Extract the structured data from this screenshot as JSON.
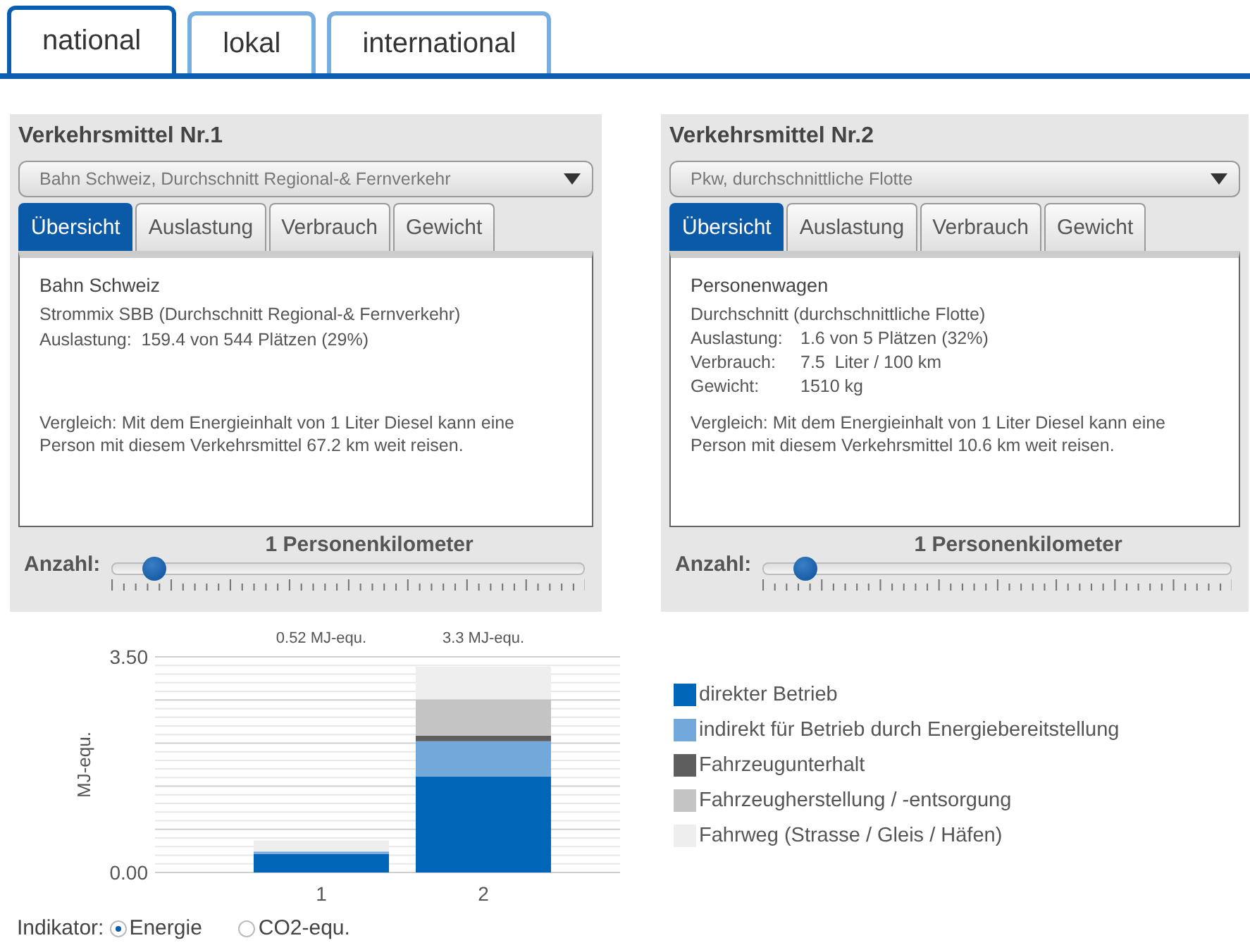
{
  "tabs": [
    {
      "label": "national",
      "selected": true
    },
    {
      "label": "lokal",
      "selected": false
    },
    {
      "label": "international",
      "selected": false
    }
  ],
  "panels": [
    {
      "title": "Verkehrsmittel Nr.1",
      "select": {
        "value": "Bahn Schweiz, Durchschnitt Regional-& Fernverkehr"
      },
      "tabs": [
        {
          "label": "Übersicht",
          "selected": true
        },
        {
          "label": "Auslastung",
          "selected": false
        },
        {
          "label": "Verbrauch",
          "selected": false
        },
        {
          "label": "Gewicht",
          "selected": false
        }
      ],
      "lines": [
        {
          "kind": "heading",
          "text": "Bahn Schweiz"
        },
        {
          "kind": "text",
          "text": "Strommix SBB (Durchschnitt Regional-& Fernverkehr)"
        },
        {
          "kind": "text",
          "text": "Auslastung:  159.4 von 544 Plätzen (29%)"
        }
      ],
      "comparison": "Vergleich: Mit dem Energieinhalt von 1 Liter Diesel kann eine Person mit diesem Verkehrsmittel 67.2 km weit reisen.",
      "slider": {
        "label": "Anzahl:",
        "reading": "1 Personenkilometer",
        "level": 0.09
      }
    },
    {
      "title": "Verkehrsmittel Nr.2",
      "select": {
        "value": "Pkw, durchschnittliche Flotte"
      },
      "tabs": [
        {
          "label": "Übersicht",
          "selected": true
        },
        {
          "label": "Auslastung",
          "selected": false
        },
        {
          "label": "Verbrauch",
          "selected": false
        },
        {
          "label": "Gewicht",
          "selected": false
        }
      ],
      "lines": [
        {
          "kind": "heading",
          "text": "Personenwagen"
        },
        {
          "kind": "text",
          "text": "Durchschnitt (durchschnittliche Flotte)"
        },
        {
          "kind": "pair",
          "label": "Auslastung:",
          "text": "1.6 von 5 Plätzen (32%)"
        },
        {
          "kind": "pair",
          "label": "Verbrauch:",
          "text": "7.5  Liter / 100 km"
        },
        {
          "kind": "pair",
          "label": "Gewicht:",
          "text": "1510 kg"
        }
      ],
      "comparison": "Vergleich: Mit dem Energieinhalt von 1 Liter Diesel kann eine Person mit diesem Verkehrsmittel 10.6 km weit reisen.",
      "slider": {
        "label": "Anzahl:",
        "reading": "1 Personenkilometer",
        "level": 0.09
      }
    }
  ],
  "chart": {
    "chart_data": {
      "type": "bar",
      "stacked": true,
      "ylabel": "MJ-equ.",
      "categories": [
        "1",
        "2"
      ],
      "ylim": [
        0,
        3.5
      ],
      "yticks": [
        {
          "value": 0,
          "label": "0.00"
        },
        {
          "value": 3.5,
          "label": "3.50"
        }
      ],
      "value_labels": [
        "0.52 MJ-equ.",
        "3.3 MJ-equ."
      ],
      "series": [
        {
          "name": "direkter Betrieb",
          "color": "#0066b8",
          "values": [
            0.3,
            1.56
          ]
        },
        {
          "name": "indirekt für Betrieb durch Energiebereitstellung",
          "color": "#72a9da",
          "values": [
            0.04,
            0.57
          ]
        },
        {
          "name": "Fahrzeugunterhalt",
          "color": "#5e5e5e",
          "values": [
            0,
            0.09
          ]
        },
        {
          "name": "Fahrzeugherstellung /  -entsorgung",
          "color": "#c4c4c4",
          "values": [
            0,
            0.59
          ]
        },
        {
          "name": "Fahrweg  (Strasse / Gleis / Häfen)",
          "color": "#eeeeee",
          "values": [
            0.18,
            0.53
          ]
        }
      ]
    }
  },
  "indicator": {
    "label": "Indikator:",
    "options": [
      {
        "label": "Energie",
        "selected": true
      },
      {
        "label": "CO2-equ.",
        "selected": false
      }
    ]
  }
}
